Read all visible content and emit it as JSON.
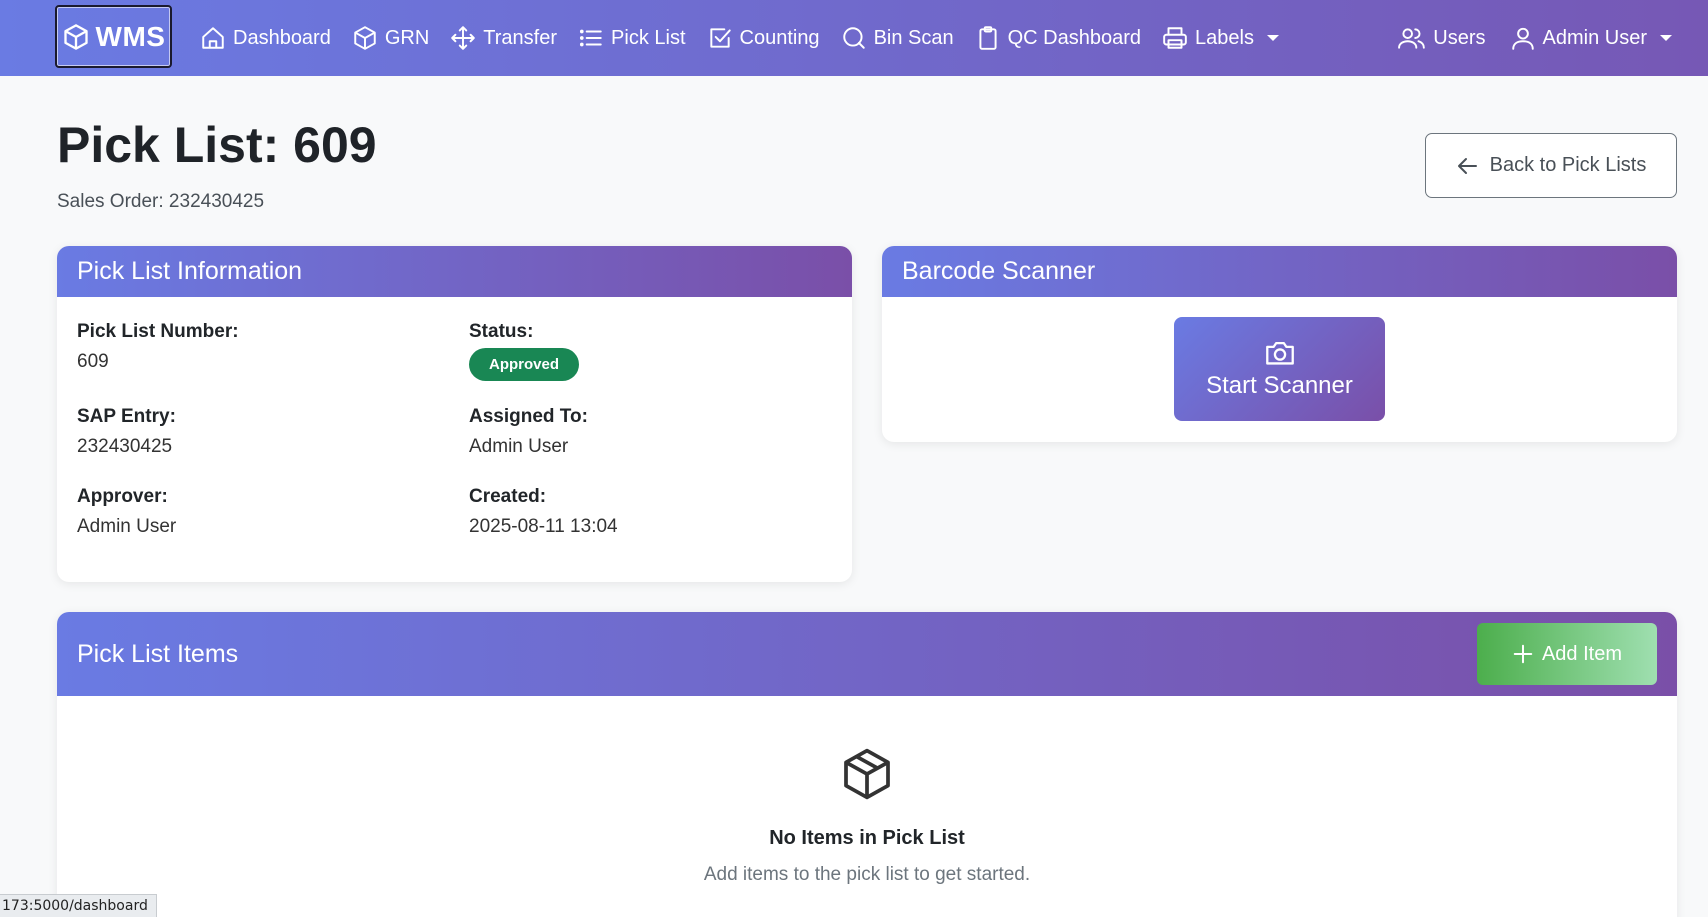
{
  "navbar": {
    "brand": "WMS",
    "items": [
      {
        "label": "Dashboard",
        "icon": "home-icon"
      },
      {
        "label": "GRN",
        "icon": "box-icon"
      },
      {
        "label": "Transfer",
        "icon": "arrows-move-icon"
      },
      {
        "label": "Pick List",
        "icon": "list-icon"
      },
      {
        "label": "Counting",
        "icon": "check-square-icon"
      },
      {
        "label": "Bin Scan",
        "icon": "search-icon"
      },
      {
        "label": "QC Dashboard",
        "icon": "clipboard-icon"
      },
      {
        "label": "Labels",
        "icon": "printer-icon"
      }
    ],
    "users_label": "Users",
    "user_label": "Admin User"
  },
  "page": {
    "title": "Pick List: 609",
    "subtitle": "Sales Order: 232430425",
    "back_label": "Back to Pick Lists"
  },
  "info": {
    "header": "Pick List Information",
    "pick_list_number_label": "Pick List Number:",
    "pick_list_number": "609",
    "status_label": "Status:",
    "status": "Approved",
    "sap_entry_label": "SAP Entry:",
    "sap_entry": "232430425",
    "assigned_label": "Assigned To:",
    "assigned": "Admin User",
    "approver_label": "Approver:",
    "approver": "Admin User",
    "created_label": "Created:",
    "created": "2025-08-11 13:04"
  },
  "scanner": {
    "header": "Barcode Scanner",
    "button_label": "Start Scanner"
  },
  "items": {
    "header": "Pick List Items",
    "add_label": "Add Item",
    "empty_title": "No Items in Pick List",
    "empty_sub": "Add items to the pick list to get started."
  },
  "statusbar": {
    "url": "173:5000/dashboard"
  },
  "colors": {
    "gradient_start": "#6a7be3",
    "gradient_end": "#7658b5",
    "badge_green": "#198754",
    "add_green": "#4cae4c"
  }
}
